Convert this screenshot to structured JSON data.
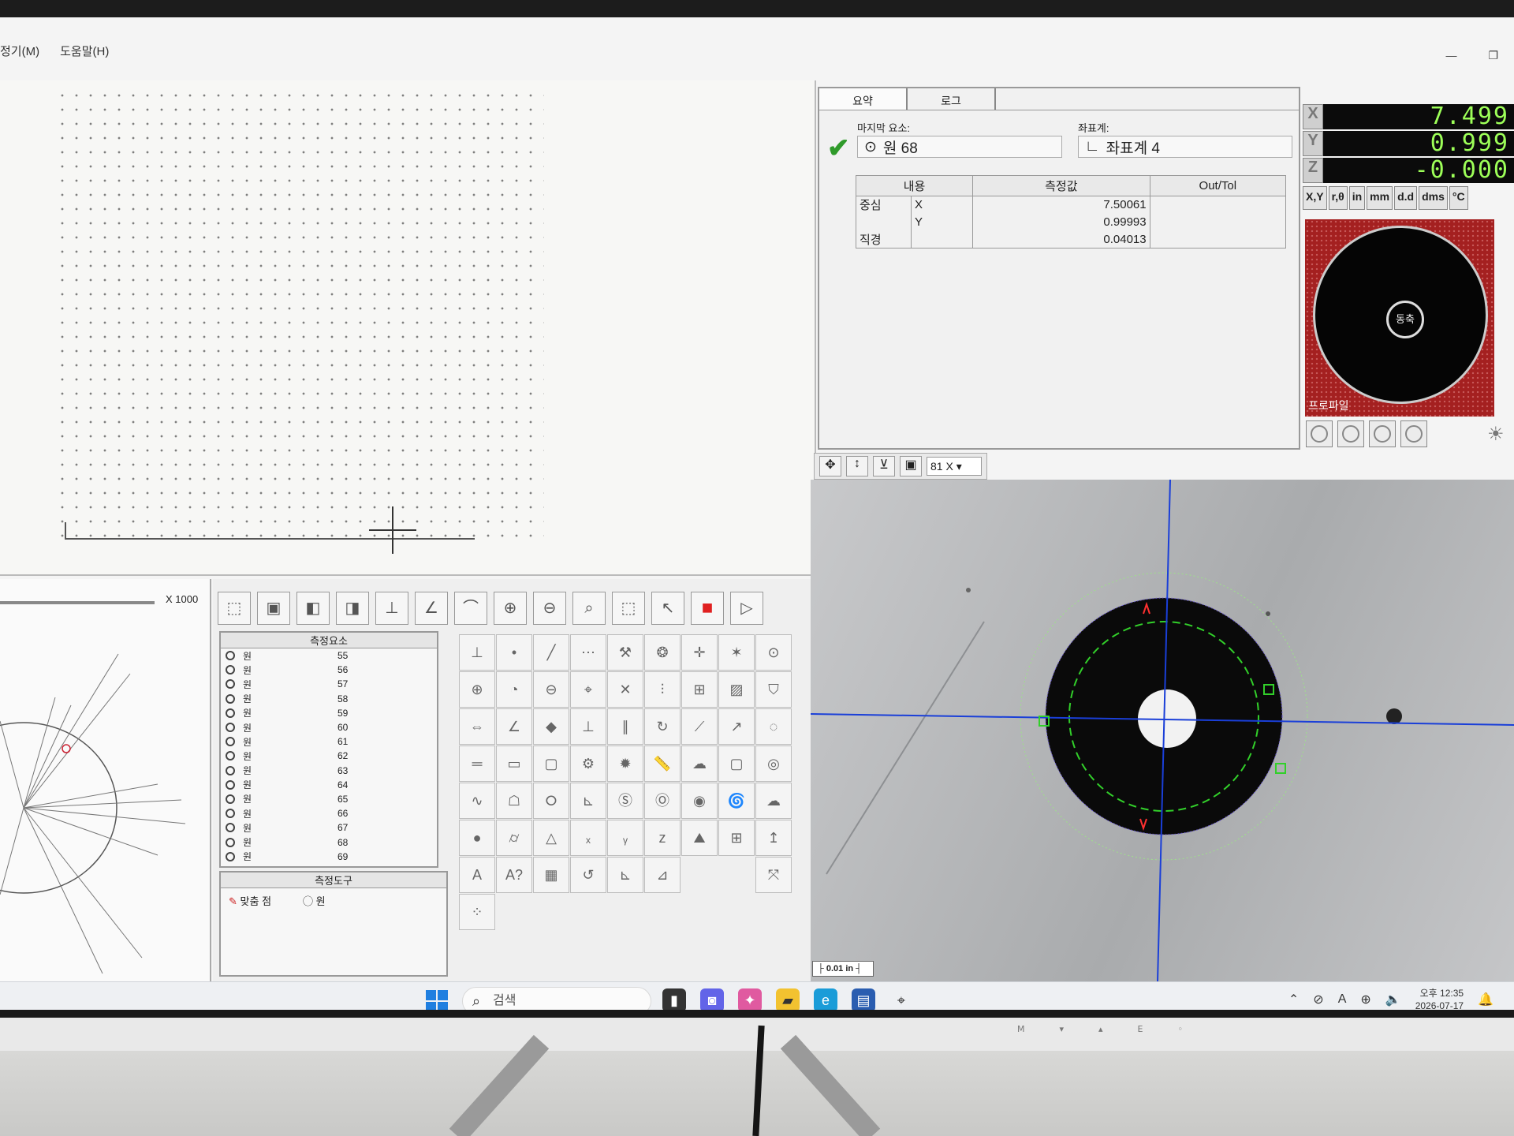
{
  "menu": [
    "정기(M)",
    "도움말(H)"
  ],
  "window_controls": [
    "—",
    "❐"
  ],
  "summary": {
    "tabs": [
      "요약",
      "로그"
    ],
    "last_element_label": "마지막 요소:",
    "last_element_value": "원 68",
    "coord_label": "좌표계:",
    "coord_value": "좌표계 4",
    "table_headers": [
      "내용",
      "측정값",
      "Out/Tol"
    ],
    "rows": [
      {
        "content": "중심",
        "axis": "X",
        "value": "7.50061",
        "tol": ""
      },
      {
        "content": "",
        "axis": "Y",
        "value": "0.99993",
        "tol": ""
      },
      {
        "content": "직경",
        "axis": "",
        "value": "0.04013",
        "tol": ""
      }
    ]
  },
  "dro": {
    "axes": [
      {
        "axis": "X",
        "value": "7.499"
      },
      {
        "axis": "Y",
        "value": "0.999"
      },
      {
        "axis": "Z",
        "value": "-0.000"
      }
    ],
    "unit_buttons": [
      "X,Y",
      "r,θ",
      "in",
      "mm",
      "d.d",
      "dms",
      "°C"
    ]
  },
  "light": {
    "hub_label": "동축",
    "dial_label": "프로파일"
  },
  "video": {
    "zoom": "81 X",
    "scale_bar": "0.01 in"
  },
  "plot": {
    "scale_label": "X 1000"
  },
  "elements": {
    "header": "측정요소",
    "items": [
      {
        "name": "원",
        "id": "55"
      },
      {
        "name": "원",
        "id": "56"
      },
      {
        "name": "원",
        "id": "57"
      },
      {
        "name": "원",
        "id": "58"
      },
      {
        "name": "원",
        "id": "59"
      },
      {
        "name": "원",
        "id": "60"
      },
      {
        "name": "원",
        "id": "61"
      },
      {
        "name": "원",
        "id": "62"
      },
      {
        "name": "원",
        "id": "63"
      },
      {
        "name": "원",
        "id": "64"
      },
      {
        "name": "원",
        "id": "65"
      },
      {
        "name": "원",
        "id": "66"
      },
      {
        "name": "원",
        "id": "67"
      },
      {
        "name": "원",
        "id": "68"
      },
      {
        "name": "원",
        "id": "69"
      }
    ]
  },
  "tools": {
    "header": "측정도구",
    "items": [
      "맞춤 점",
      "원"
    ]
  },
  "taskbar": {
    "search": "검색",
    "time": "오후 12:35",
    "date": "2026-07-17",
    "lang": "A"
  },
  "colors": {
    "dro_text": "#9dff58",
    "crosshair": "#1a3fd8",
    "fit_circle": "#32d02a",
    "dial_red": "#a42020"
  }
}
